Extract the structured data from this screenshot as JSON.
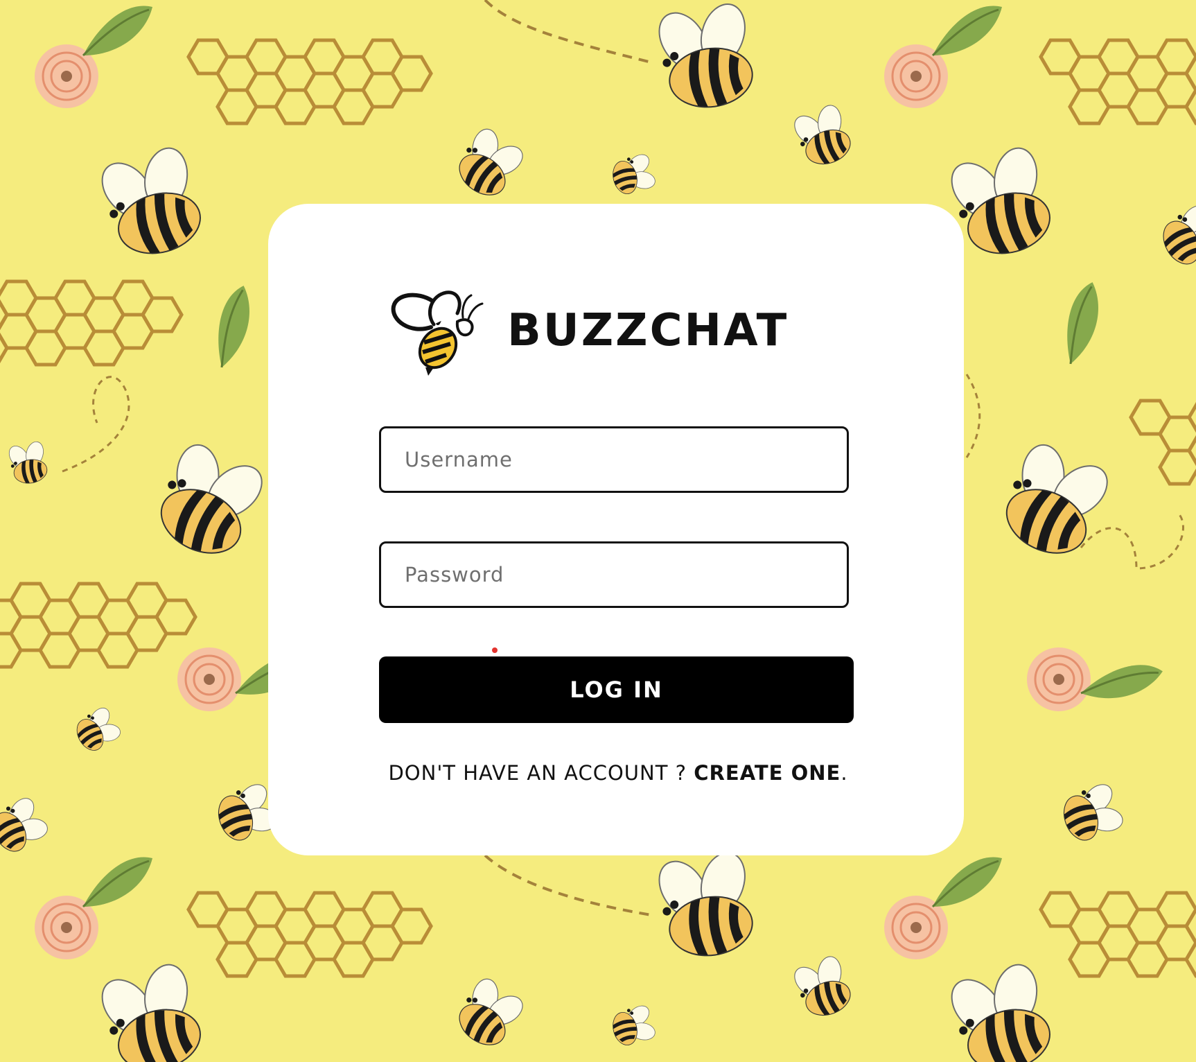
{
  "app": {
    "name": "BUZZCHAT"
  },
  "login_form": {
    "username_placeholder": "Username",
    "password_placeholder": "Password",
    "submit_label": "LOG IN"
  },
  "signup": {
    "prompt": "DON'T HAVE AN ACCOUNT ? ",
    "link_label": "CREATE ONE",
    "suffix": "."
  },
  "colors": {
    "background": "#f5ec7e",
    "card": "#ffffff",
    "button": "#000000",
    "button_text": "#ffffff",
    "bee_yellow": "#f2c45c",
    "bee_stripe": "#1a1a1a",
    "honeycomb": "#b98d37",
    "flower": "#efae8a",
    "leaf": "#86a94c",
    "accent_dot": "#e3342f"
  },
  "icons": {
    "logo": "bee-logo-icon",
    "background_bee": "bee-icon",
    "background_flower": "flower-icon",
    "background_leaf": "leaf-icon",
    "background_honeycomb": "honeycomb-icon"
  }
}
